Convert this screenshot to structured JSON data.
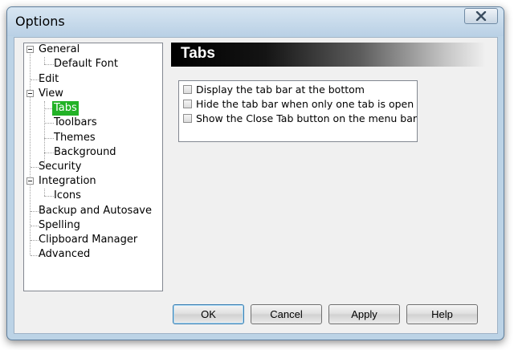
{
  "window": {
    "title": "Options"
  },
  "tree": {
    "general": "General",
    "default_font": "Default Font",
    "edit": "Edit",
    "view": "View",
    "tabs": "Tabs",
    "toolbars": "Toolbars",
    "themes": "Themes",
    "background": "Background",
    "security": "Security",
    "integration": "Integration",
    "icons": "Icons",
    "backup": "Backup and Autosave",
    "spelling": "Spelling",
    "clipboard": "Clipboard Manager",
    "advanced": "Advanced",
    "selected": "Tabs"
  },
  "panel": {
    "title": "Tabs",
    "options": [
      {
        "label": "Display the tab bar at the bottom",
        "checked": false
      },
      {
        "label": "Hide the tab bar when only one tab is open",
        "checked": false
      },
      {
        "label": "Show the Close Tab button on the menu bar",
        "checked": false
      }
    ]
  },
  "buttons": {
    "ok": "OK",
    "cancel": "Cancel",
    "apply": "Apply",
    "help": "Help"
  }
}
